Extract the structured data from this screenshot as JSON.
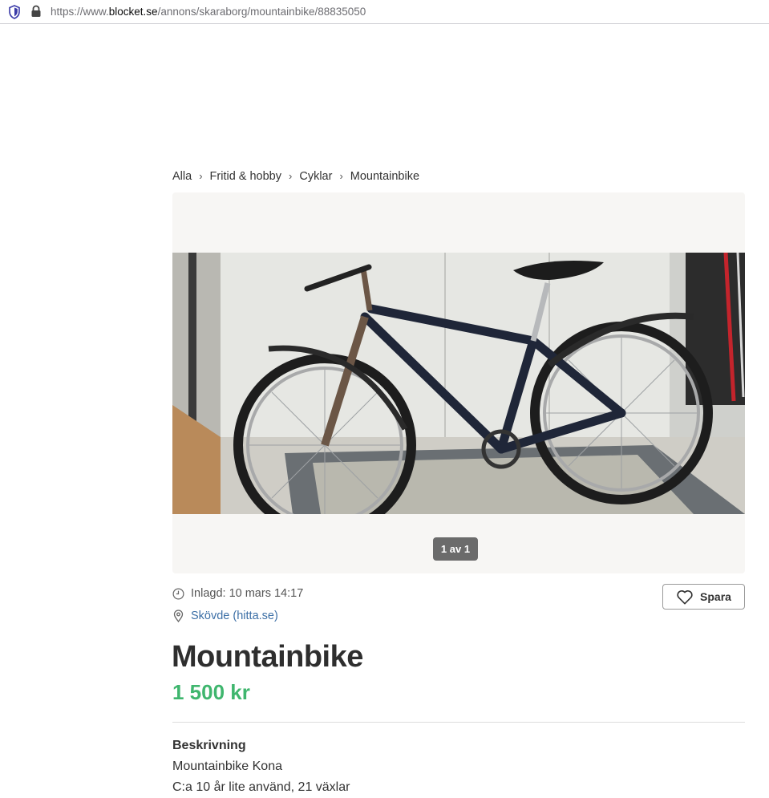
{
  "browser": {
    "url_prefix": "https://www.",
    "url_host": "blocket.se",
    "url_path": "/annons/skaraborg/mountainbike/88835050"
  },
  "breadcrumb": {
    "items": [
      "Alla",
      "Fritid & hobby",
      "Cyklar",
      "Mountainbike"
    ],
    "separator": "›"
  },
  "gallery": {
    "counter": "1 av 1"
  },
  "meta": {
    "posted": "Inlagd: 10 mars 14:17",
    "location": "Skövde (hitta.se)"
  },
  "actions": {
    "save_label": "Spara"
  },
  "listing": {
    "title": "Mountainbike",
    "price": "1 500 kr"
  },
  "description": {
    "heading": "Beskrivning",
    "lines": [
      "Mountainbike Kona",
      "C:a 10 år lite använd, 21 växlar"
    ]
  },
  "colors": {
    "price": "#3fb66e",
    "link": "#3c6fa6",
    "gallery_bg": "#f7f6f4"
  }
}
